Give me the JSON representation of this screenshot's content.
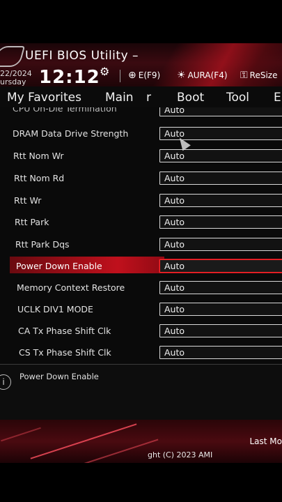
{
  "header": {
    "title": "UEFI BIOS Utility – ",
    "date": "22/2024",
    "weekday": "ursday",
    "time": "12:12",
    "hotkeys": [
      {
        "icon": "globe-icon",
        "label": "E(F9)"
      },
      {
        "icon": "aura-icon",
        "label": "AURA(F4)"
      },
      {
        "icon": "resize-icon",
        "label": "ReSize"
      }
    ]
  },
  "tabs": [
    "My Favorites",
    "Main",
    "r",
    "Boot",
    "Tool",
    "E"
  ],
  "settings": [
    {
      "label": "CPU On-Die Termination",
      "value": "Auto"
    },
    {
      "label": "DRAM Data Drive Strength",
      "value": "Auto"
    },
    {
      "label": "Rtt Nom Wr",
      "value": "Auto"
    },
    {
      "label": "Rtt Nom Rd",
      "value": "Auto"
    },
    {
      "label": "Rtt Wr",
      "value": "Auto"
    },
    {
      "label": "Rtt Park",
      "value": "Auto"
    },
    {
      "label": "Rtt Park Dqs",
      "value": "Auto"
    },
    {
      "label": "Power Down Enable",
      "value": "Auto"
    },
    {
      "label": "Memory Context Restore",
      "value": "Auto"
    },
    {
      "label": "UCLK DIV1 MODE",
      "value": "Auto"
    },
    {
      "label": "CA Tx Phase Shift Clk",
      "value": "Auto"
    },
    {
      "label": "CS Tx Phase Shift Clk",
      "value": "Auto"
    }
  ],
  "info": {
    "text": "Power Down Enable"
  },
  "footer": {
    "last_modified": "Last Mo",
    "copyright": "ght (C) 2023 AMI"
  },
  "colors": {
    "accent": "#c0101c",
    "background": "#0a0a0a"
  }
}
